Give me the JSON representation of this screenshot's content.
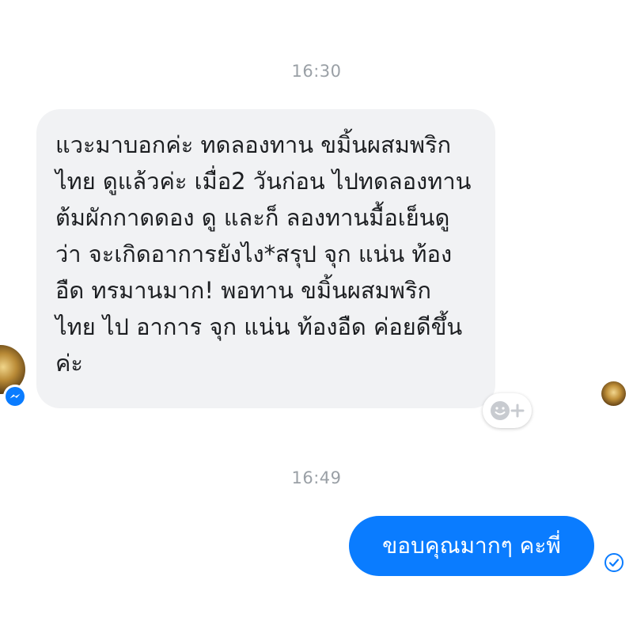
{
  "conversation": {
    "timestamp_1": "16:30",
    "incoming_message": "แวะมาบอกค่ะ ทดลองทาน ขมิ้นผสมพริก\nไทย ดูแล้วค่ะ เมื่อ2 วันก่อน ไปทดลองทาน\nต้มผักกาดดอง ดู และก็ ลองทานมื้อเย็นดู\nว่า จะเกิดอาการยังไง*สรุป จุก แน่น ท้อง\nอืด ทรมานมาก! พอทาน ขมิ้นผสมพริก\nไทย ไป อาการ จุก แน่น ท้องอืด ค่อยดีขึ้น\nค่ะ",
    "timestamp_2": "16:49",
    "outgoing_message": "ขอบคุณมากๆ คะพี่"
  },
  "icons": {
    "react": "smiley-plus-icon",
    "platform_badge": "messenger-icon",
    "status": "sent-check-icon"
  },
  "colors": {
    "outgoing_bubble": "#0a7cff",
    "incoming_bubble": "#f1f2f4",
    "timestamp": "#9aa0a6",
    "messenger_badge": "#0a7cff"
  }
}
